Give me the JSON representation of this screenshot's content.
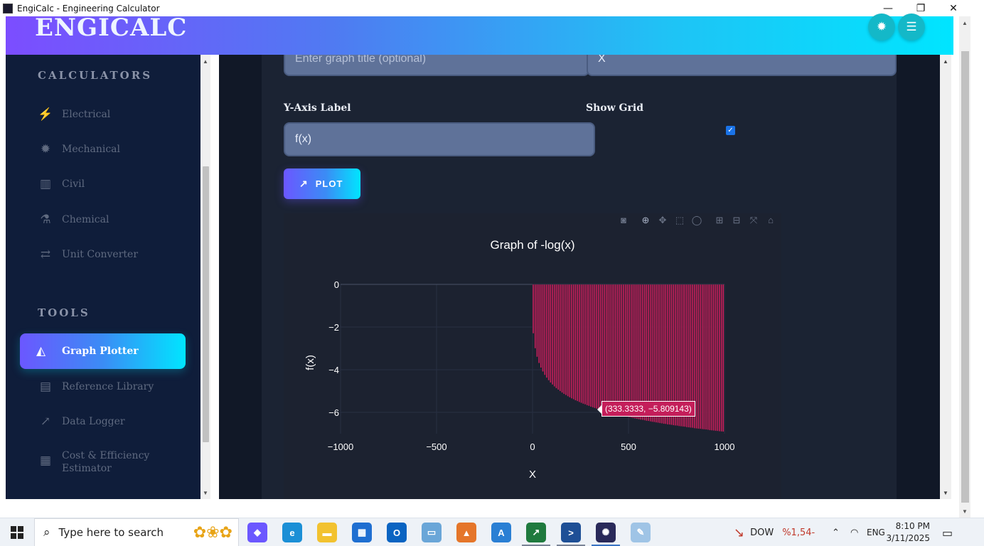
{
  "window": {
    "title": "EngiCalc - Engineering Calculator",
    "minimize_icon": "minimize-icon",
    "restore_icon": "restore-icon",
    "close_icon": "close-icon"
  },
  "header": {
    "brand": "ENGICALC",
    "settings_icon": "gear-icon",
    "menu_icon": "menu-icon",
    "accent_colors": [
      "#7c4dff",
      "#00e5ff"
    ]
  },
  "sidebar": {
    "calculators_heading": "CALCULATORS",
    "calculators": [
      {
        "label": "Electrical",
        "icon": "bolt-icon"
      },
      {
        "label": "Mechanical",
        "icon": "gear-icon"
      },
      {
        "label": "Civil",
        "icon": "building-icon"
      },
      {
        "label": "Chemical",
        "icon": "flask-icon"
      },
      {
        "label": "Unit Converter",
        "icon": "exchange-icon"
      }
    ],
    "tools_heading": "TOOLS",
    "tools": [
      {
        "label": "Graph Plotter",
        "icon": "area-chart-icon",
        "active": true
      },
      {
        "label": "Reference Library",
        "icon": "book-icon"
      },
      {
        "label": "Data Logger",
        "icon": "line-chart-icon"
      },
      {
        "label": "Cost & Efficiency Estimator",
        "icon": "calculator-icon"
      }
    ]
  },
  "form": {
    "title_placeholder": "Enter graph title (optional)",
    "x_label_value": "X",
    "y_label_heading": "Y-Axis Label",
    "y_label_value": "f(x)",
    "show_grid_heading": "Show Grid",
    "show_grid_checked": true,
    "plot_button": "PLOT"
  },
  "graph": {
    "modebar": [
      "camera-icon",
      "zoom-icon",
      "pan-icon",
      "box-select-icon",
      "lasso-icon",
      "zoom-in-icon",
      "zoom-out-icon",
      "autoscale-icon",
      "reset-axes-icon"
    ],
    "hover_label": "(333.3333, −5.809143)",
    "bar_color": "#c41e5a"
  },
  "chart_data": {
    "type": "bar",
    "title": "Graph of -log(x)",
    "xlabel": "X",
    "ylabel": "f(x)",
    "xlim": [
      -1000,
      1000
    ],
    "ylim": [
      -7,
      0
    ],
    "x_ticks": [
      "−1000",
      "−500",
      "0",
      "500",
      "1000"
    ],
    "y_ticks": [
      "0",
      "−2",
      "−4",
      "−6"
    ],
    "grid": true,
    "x": [
      10,
      20,
      30,
      40,
      50,
      60,
      70,
      80,
      90,
      100,
      110,
      120,
      130,
      140,
      150,
      160,
      170,
      180,
      190,
      200,
      210,
      220,
      230,
      240,
      250,
      260,
      270,
      280,
      290,
      300,
      310,
      320,
      330,
      340,
      350,
      360,
      370,
      380,
      390,
      400,
      410,
      420,
      430,
      440,
      450,
      460,
      470,
      480,
      490,
      500,
      510,
      520,
      530,
      540,
      550,
      560,
      570,
      580,
      590,
      600,
      610,
      620,
      630,
      640,
      650,
      660,
      670,
      680,
      690,
      700,
      710,
      720,
      730,
      740,
      750,
      760,
      770,
      780,
      790,
      800,
      810,
      820,
      830,
      840,
      850,
      860,
      870,
      880,
      890,
      900,
      910,
      920,
      930,
      940,
      950,
      960,
      970,
      980,
      990,
      1000
    ],
    "values": [
      -2.3,
      -3.0,
      -3.4,
      -3.69,
      -3.91,
      -4.09,
      -4.25,
      -4.38,
      -4.5,
      -4.61,
      -4.7,
      -4.79,
      -4.87,
      -4.94,
      -5.01,
      -5.08,
      -5.14,
      -5.19,
      -5.25,
      -5.3,
      -5.35,
      -5.39,
      -5.44,
      -5.48,
      -5.52,
      -5.56,
      -5.6,
      -5.63,
      -5.67,
      -5.7,
      -5.74,
      -5.77,
      -5.8,
      -5.83,
      -5.86,
      -5.89,
      -5.91,
      -5.94,
      -5.97,
      -5.99,
      -6.02,
      -6.04,
      -6.06,
      -6.09,
      -6.11,
      -6.13,
      -6.15,
      -6.17,
      -6.19,
      -6.21,
      -6.23,
      -6.25,
      -6.27,
      -6.29,
      -6.31,
      -6.33,
      -6.35,
      -6.36,
      -6.38,
      -6.4,
      -6.41,
      -6.43,
      -6.45,
      -6.46,
      -6.48,
      -6.49,
      -6.51,
      -6.52,
      -6.54,
      -6.55,
      -6.57,
      -6.58,
      -6.59,
      -6.61,
      -6.62,
      -6.63,
      -6.65,
      -6.66,
      -6.67,
      -6.68,
      -6.7,
      -6.71,
      -6.72,
      -6.73,
      -6.75,
      -6.76,
      -6.77,
      -6.78,
      -6.79,
      -6.8,
      -6.81,
      -6.82,
      -6.84,
      -6.85,
      -6.86,
      -6.87,
      -6.88,
      -6.89,
      -6.9,
      -6.91
    ]
  },
  "taskbar": {
    "search_placeholder": "Type here to search",
    "stock_ticker": "DOW",
    "stock_change": "%1,54-",
    "language": "ENG",
    "time": "8:10 PM",
    "date": "3/11/2025",
    "apps": [
      "copilot-icon",
      "edge-icon",
      "file-explorer-icon",
      "store-icon",
      "outlook-icon",
      "network-icon",
      "matlab-icon",
      "vscode-icon",
      "excel-icon",
      "powershell-icon",
      "app-icon",
      "paint-icon"
    ]
  }
}
